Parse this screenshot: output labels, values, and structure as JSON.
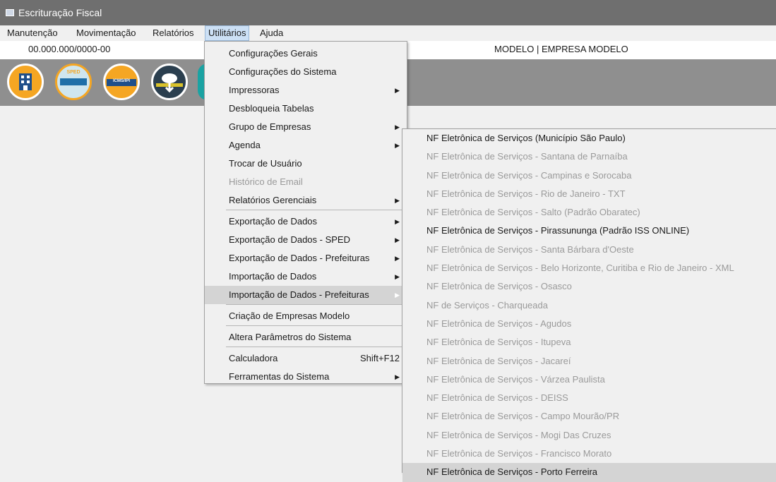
{
  "window": {
    "title": "Escrituração Fiscal"
  },
  "menubar": [
    "Manutenção",
    "Movimentação",
    "Relatórios",
    "Utilitários",
    "Ajuda"
  ],
  "infobar": {
    "cnpj": "00.000.000/0000-00",
    "empresa": "MODELO | EMPRESA MODELO"
  },
  "toolbar": {
    "icons": [
      {
        "name": "building-icon",
        "color": "#f5a623"
      },
      {
        "name": "sped-contribuicoes-icon",
        "label": "SPED",
        "color": "#cfe6ef"
      },
      {
        "name": "icms-ipi-icon",
        "label": "ICMS/IPI",
        "color": "#f5a623"
      },
      {
        "name": "cloud-download-icon",
        "color": "#2b3f4f"
      },
      {
        "name": "partial-icon",
        "color": "#1aa3a3"
      }
    ]
  },
  "utilitarios_menu": [
    {
      "label": "Configurações Gerais"
    },
    {
      "label": "Configurações do Sistema"
    },
    {
      "label": "Impressoras",
      "submenu": true
    },
    {
      "label": "Desbloqueia Tabelas"
    },
    {
      "label": "Grupo de Empresas",
      "submenu": true
    },
    {
      "label": "Agenda",
      "submenu": true
    },
    {
      "label": "Trocar de Usuário"
    },
    {
      "label": "Histórico de Email",
      "disabled": true
    },
    {
      "label": "Relatórios Gerenciais",
      "submenu": true,
      "sep_after": true
    },
    {
      "label": "Exportação de Dados",
      "submenu": true
    },
    {
      "label": "Exportação de Dados - SPED",
      "submenu": true
    },
    {
      "label": "Exportação de Dados - Prefeituras",
      "submenu": true
    },
    {
      "label": "Importação de Dados",
      "submenu": true
    },
    {
      "label": "Importação de Dados - Prefeituras",
      "submenu": true,
      "highlighted": true,
      "sep_after": true
    },
    {
      "label": "Criação de Empresas Modelo",
      "sep_after": true
    },
    {
      "label": "Altera Parâmetros do Sistema",
      "sep_after": true
    },
    {
      "label": "Calculadora",
      "shortcut": "Shift+F12"
    },
    {
      "label": "Ferramentas do Sistema",
      "submenu": true
    }
  ],
  "prefeituras_submenu": [
    {
      "label": "NF Eletrônica de Serviços (Município São Paulo)"
    },
    {
      "label": "NF Eletrônica de Serviços - Santana de Parnaíba",
      "disabled": true
    },
    {
      "label": "NF Eletrônica de Serviços - Campinas e Sorocaba",
      "disabled": true
    },
    {
      "label": "NF Eletrônica de Serviços - Rio de Janeiro - TXT",
      "disabled": true
    },
    {
      "label": "NF Eletrônica de Serviços - Salto (Padrão Obaratec)",
      "disabled": true
    },
    {
      "label": "NF Eletrônica de Serviços - Pirassununga (Padrão ISS ONLINE)"
    },
    {
      "label": "NF Eletrônica de Serviços - Santa Bárbara d'Oeste",
      "disabled": true
    },
    {
      "label": "NF Eletrônica de Serviços - Belo Horizonte, Curitiba e Rio de Janeiro - XML",
      "disabled": true
    },
    {
      "label": "NF Eletrônica de Serviços - Osasco",
      "disabled": true
    },
    {
      "label": "NF de Serviços - Charqueada",
      "disabled": true
    },
    {
      "label": "NF Eletrônica de Serviços - Agudos",
      "disabled": true
    },
    {
      "label": "NF Eletrônica de Serviços - Itupeva",
      "disabled": true
    },
    {
      "label": "NF Eletrônica de Serviços - Jacareí",
      "disabled": true
    },
    {
      "label": "NF Eletrônica de Serviços - Várzea Paulista",
      "disabled": true
    },
    {
      "label": "NF Eletrônica de Serviços - DEISS",
      "disabled": true
    },
    {
      "label": "NF Eletrônica de Serviços - Campo Mourão/PR",
      "disabled": true
    },
    {
      "label": "NF Eletrônica de Serviços - Mogi Das Cruzes",
      "disabled": true
    },
    {
      "label": "NF Eletrônica de Serviços - Francisco Morato",
      "disabled": true
    },
    {
      "label": "NF Eletrônica de Serviços - Porto Ferreira",
      "highlighted": true
    }
  ]
}
